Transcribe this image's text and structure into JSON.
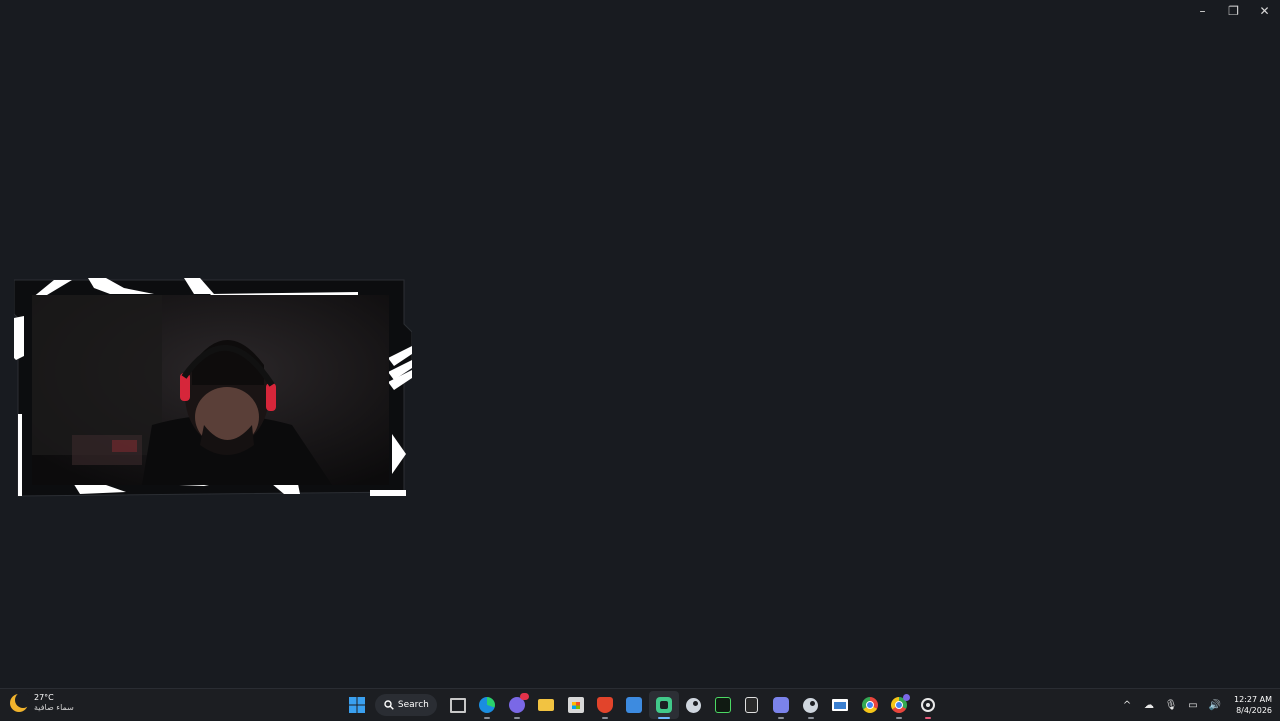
{
  "window": {
    "controls": [
      {
        "name": "minimize",
        "glyph": "–"
      },
      {
        "name": "restore",
        "glyph": "❐"
      },
      {
        "name": "close",
        "glyph": "✕"
      }
    ]
  },
  "webcam": {
    "description_icon": "webcam-overlay"
  },
  "taskbar": {
    "weather": {
      "temp": "27°C",
      "desc": "سماء صافية",
      "icon": "moon-icon"
    },
    "search_label": "Search",
    "apps": [
      {
        "name": "file-explorer-window",
        "icon": "window-icon",
        "color": "#c8c8c8"
      },
      {
        "name": "edge",
        "icon": "edge-icon",
        "color": "#2a9be0"
      },
      {
        "name": "discord",
        "icon": "discord-icon",
        "color": "#7a68e6",
        "badge": "37"
      },
      {
        "name": "file-explorer",
        "icon": "folder-icon",
        "color": "#f2c341"
      },
      {
        "name": "microsoft-store",
        "icon": "store-icon",
        "color": "#d8d8d8"
      },
      {
        "name": "brave",
        "icon": "brave-icon",
        "color": "#e2442b"
      },
      {
        "name": "mail",
        "icon": "mail-icon",
        "color": "#3d8be0"
      },
      {
        "name": "chat-app",
        "icon": "chat-icon",
        "color": "#41c98a"
      },
      {
        "name": "steam",
        "icon": "steam-icon",
        "color": "#cfd6de"
      },
      {
        "name": "app-a",
        "icon": "a-logo-icon",
        "color": "#4cd964"
      },
      {
        "name": "epic-games",
        "icon": "epic-icon",
        "color": "#e0e0e0"
      },
      {
        "name": "teams",
        "icon": "teams-icon",
        "color": "#7b83eb"
      },
      {
        "name": "steam-2",
        "icon": "steam-icon",
        "color": "#cfd6de"
      },
      {
        "name": "app-window",
        "icon": "window-icon",
        "color": "#3a7fd0"
      },
      {
        "name": "chrome",
        "icon": "chrome-icon",
        "color": "#e8453c"
      },
      {
        "name": "chrome-canary",
        "icon": "chrome-icon",
        "color": "#f0b400"
      },
      {
        "name": "obs",
        "icon": "settings-gear-icon",
        "color": "#e8e8e8"
      }
    ],
    "tray": {
      "chevron": "^",
      "icons": [
        {
          "name": "cloud-icon",
          "glyph": "☁"
        },
        {
          "name": "microphone-icon",
          "glyph": "🎙"
        },
        {
          "name": "network-icon",
          "glyph": "▭"
        },
        {
          "name": "volume-icon",
          "glyph": "🔊"
        }
      ],
      "time": "12:27 AM",
      "date": "8/4/2026"
    }
  }
}
